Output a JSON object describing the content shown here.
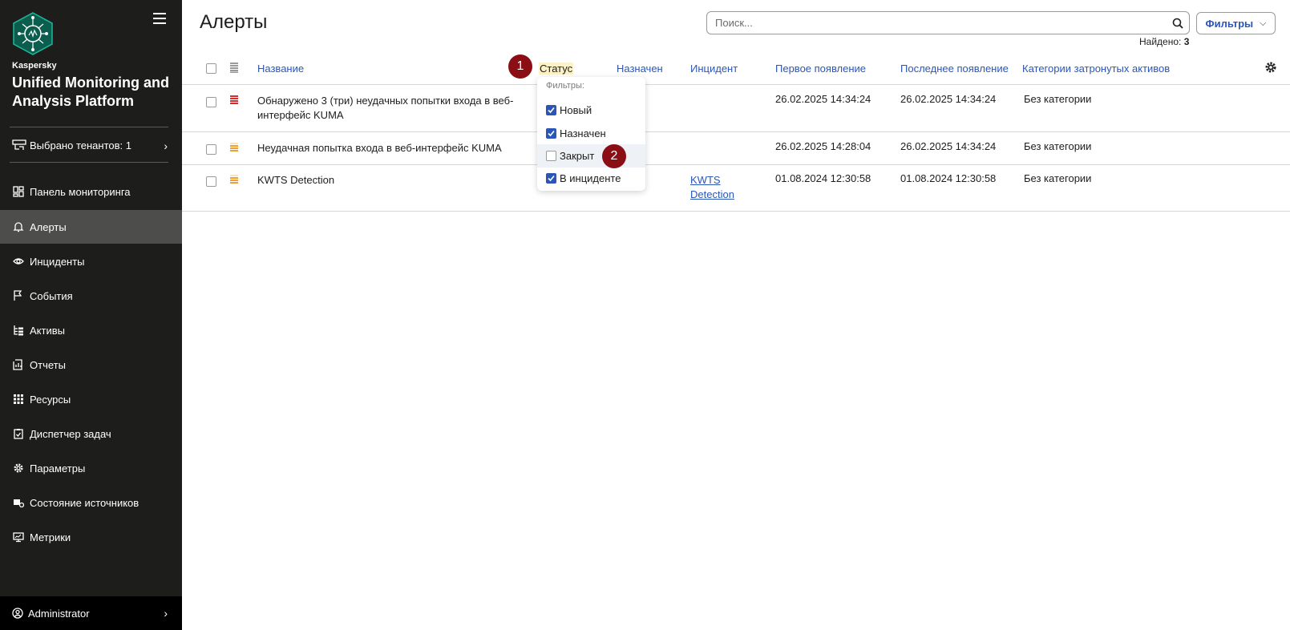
{
  "sidebar": {
    "brand_small": "Kaspersky",
    "brand_title": "Unified Monitoring and Analysis Platform",
    "tenant_label": "Выбрано тенантов: 1",
    "items": [
      {
        "label": "Панель мониторинга",
        "icon": "dashboard-icon"
      },
      {
        "label": "Алерты",
        "icon": "bell-icon",
        "active": true
      },
      {
        "label": "Инциденты",
        "icon": "eye-icon"
      },
      {
        "label": "События",
        "icon": "flag-icon"
      },
      {
        "label": "Активы",
        "icon": "tree-icon"
      },
      {
        "label": "Отчеты",
        "icon": "report-icon"
      },
      {
        "label": "Ресурсы",
        "icon": "grid-icon"
      },
      {
        "label": "Диспетчер задач",
        "icon": "task-icon"
      },
      {
        "label": "Параметры",
        "icon": "gear-icon"
      },
      {
        "label": "Состояние источников",
        "icon": "source-icon"
      },
      {
        "label": "Метрики",
        "icon": "monitor-icon"
      }
    ],
    "user": "Administrator"
  },
  "header": {
    "title": "Алерты",
    "search_placeholder": "Поиск...",
    "filters_label": "Фильтры",
    "found_label": "Найдено:",
    "found_count": "3"
  },
  "table": {
    "columns": [
      "Название",
      "Статус",
      "Назначен",
      "Инцидент",
      "Первое появление",
      "Последнее появление",
      "Категории затронутых активов"
    ],
    "rows": [
      {
        "severity": "high",
        "name": "Обнаружено 3 (три) неудачных попытки входа в веб-интерфейс KUMA",
        "incident": "",
        "first": "26.02.2025 14:34:24",
        "last": "26.02.2025 14:34:24",
        "category": "Без категории"
      },
      {
        "severity": "medium",
        "name": "Неудачная попытка входа в веб-интерфейс KUMA",
        "incident": "",
        "first": "26.02.2025 14:28:04",
        "last": "26.02.2025 14:34:24",
        "category": "Без категории"
      },
      {
        "severity": "medium",
        "name": "KWTS Detection",
        "incident": "KWTS Detection",
        "first": "01.08.2024 12:30:58",
        "last": "01.08.2024 12:30:58",
        "category": "Без категории"
      }
    ]
  },
  "status_filter": {
    "header": "Фильтры:",
    "options": [
      {
        "label": "Новый",
        "checked": true
      },
      {
        "label": "Назначен",
        "checked": true
      },
      {
        "label": "Закрыт",
        "checked": false
      },
      {
        "label": "В инциденте",
        "checked": true
      }
    ]
  },
  "callouts": [
    "1",
    "2"
  ],
  "colors": {
    "sidebar_bg": "#1d1d1b",
    "accent": "#2a56b8",
    "callout": "#8b0e14",
    "severity_high": "#d62e2e",
    "severity_medium": "#f0a030"
  }
}
